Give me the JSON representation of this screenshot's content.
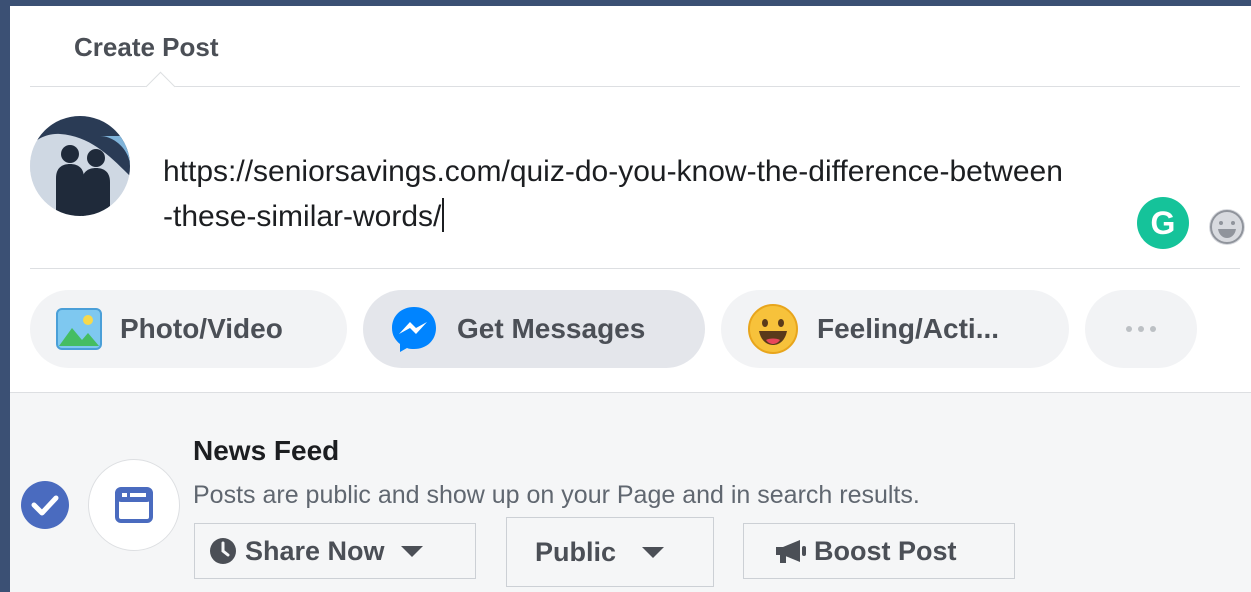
{
  "header": {
    "tab_label": "Create Post"
  },
  "composer": {
    "text": "https://seniorsavings.com/quiz-do-you-know-the-difference-between-these-similar-words/",
    "grammarly_letter": "G"
  },
  "actions": {
    "photo_video": "Photo/Video",
    "get_messages": "Get Messages",
    "feeling": "Feeling/Acti..."
  },
  "destination": {
    "title": "News Feed",
    "description": "Posts are public and show up on your Page and in search results."
  },
  "controls": {
    "share_now": "Share Now",
    "audience": "Public",
    "boost": "Boost Post"
  },
  "colors": {
    "accent": "#4a6bbf",
    "grammarly": "#15c39a",
    "messenger": "#0084ff"
  }
}
